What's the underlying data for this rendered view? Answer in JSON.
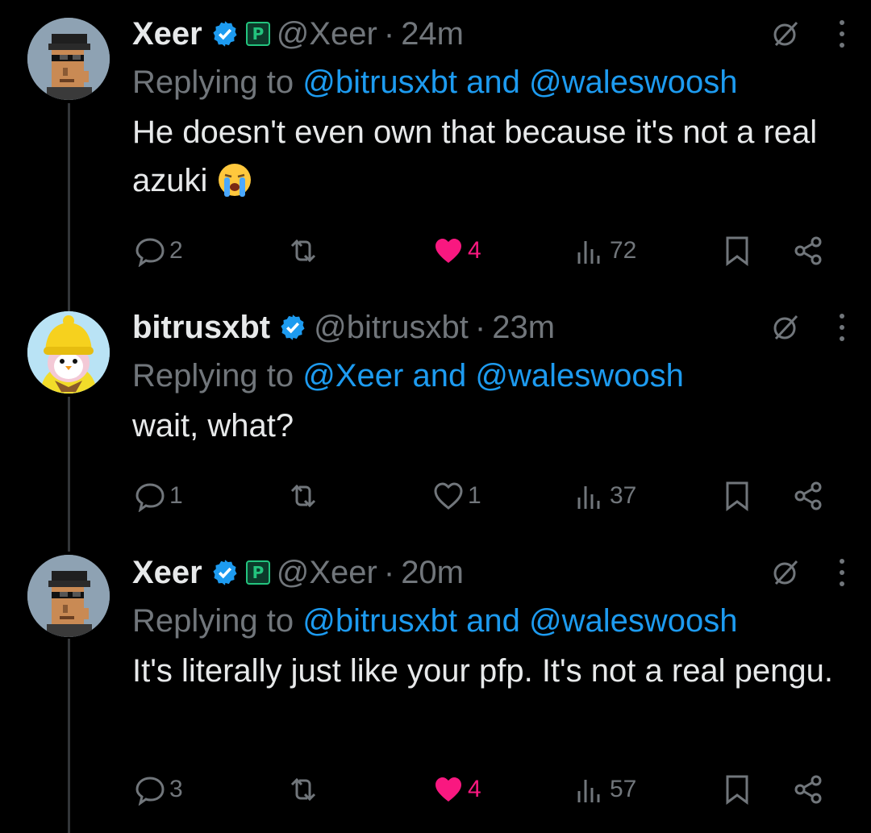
{
  "tweets": [
    {
      "name": "Xeer",
      "handle": "@Xeer",
      "time": "24m",
      "replying_prefix": "Replying to",
      "mention1": "@bitrusxbt",
      "conj": "and",
      "mention2": "@waleswoosh",
      "text": "He doesn't even own that because it's not a real azuki",
      "emoji": "loudly-crying-face",
      "avatar": "pixel-punk-avatar",
      "replies": "2",
      "retweets": "",
      "likes": "4",
      "liked": true,
      "views": "72"
    },
    {
      "name": "bitrusxbt",
      "handle": "@bitrusxbt",
      "time": "23m",
      "replying_prefix": "Replying to",
      "mention1": "@Xeer",
      "conj": "and",
      "mention2": "@waleswoosh",
      "text": "wait, what?",
      "avatar": "penguin-avatar",
      "replies": "1",
      "retweets": "",
      "likes": "1",
      "liked": false,
      "views": "37"
    },
    {
      "name": "Xeer",
      "handle": "@Xeer",
      "time": "20m",
      "replying_prefix": "Replying to",
      "mention1": "@bitrusxbt",
      "conj": "and",
      "mention2": "@waleswoosh",
      "text": "It's literally just like your pfp. It's not a real pengu.",
      "avatar": "pixel-punk-avatar",
      "replies": "3",
      "retweets": "",
      "likes": "4",
      "liked": true,
      "views": "57"
    }
  ],
  "sep": "·",
  "colors": {
    "background": "#000000",
    "text": "#e7e9ea",
    "muted": "#71767b",
    "mention": "#1d9bf0",
    "like": "#f91880",
    "verified": "#1d9bf0"
  },
  "icons": [
    "verified-icon",
    "ticker-badge-icon",
    "grok-icon",
    "more-icon",
    "reply-icon",
    "retweet-icon",
    "like-icon",
    "views-icon",
    "bookmark-icon",
    "share-icon"
  ]
}
